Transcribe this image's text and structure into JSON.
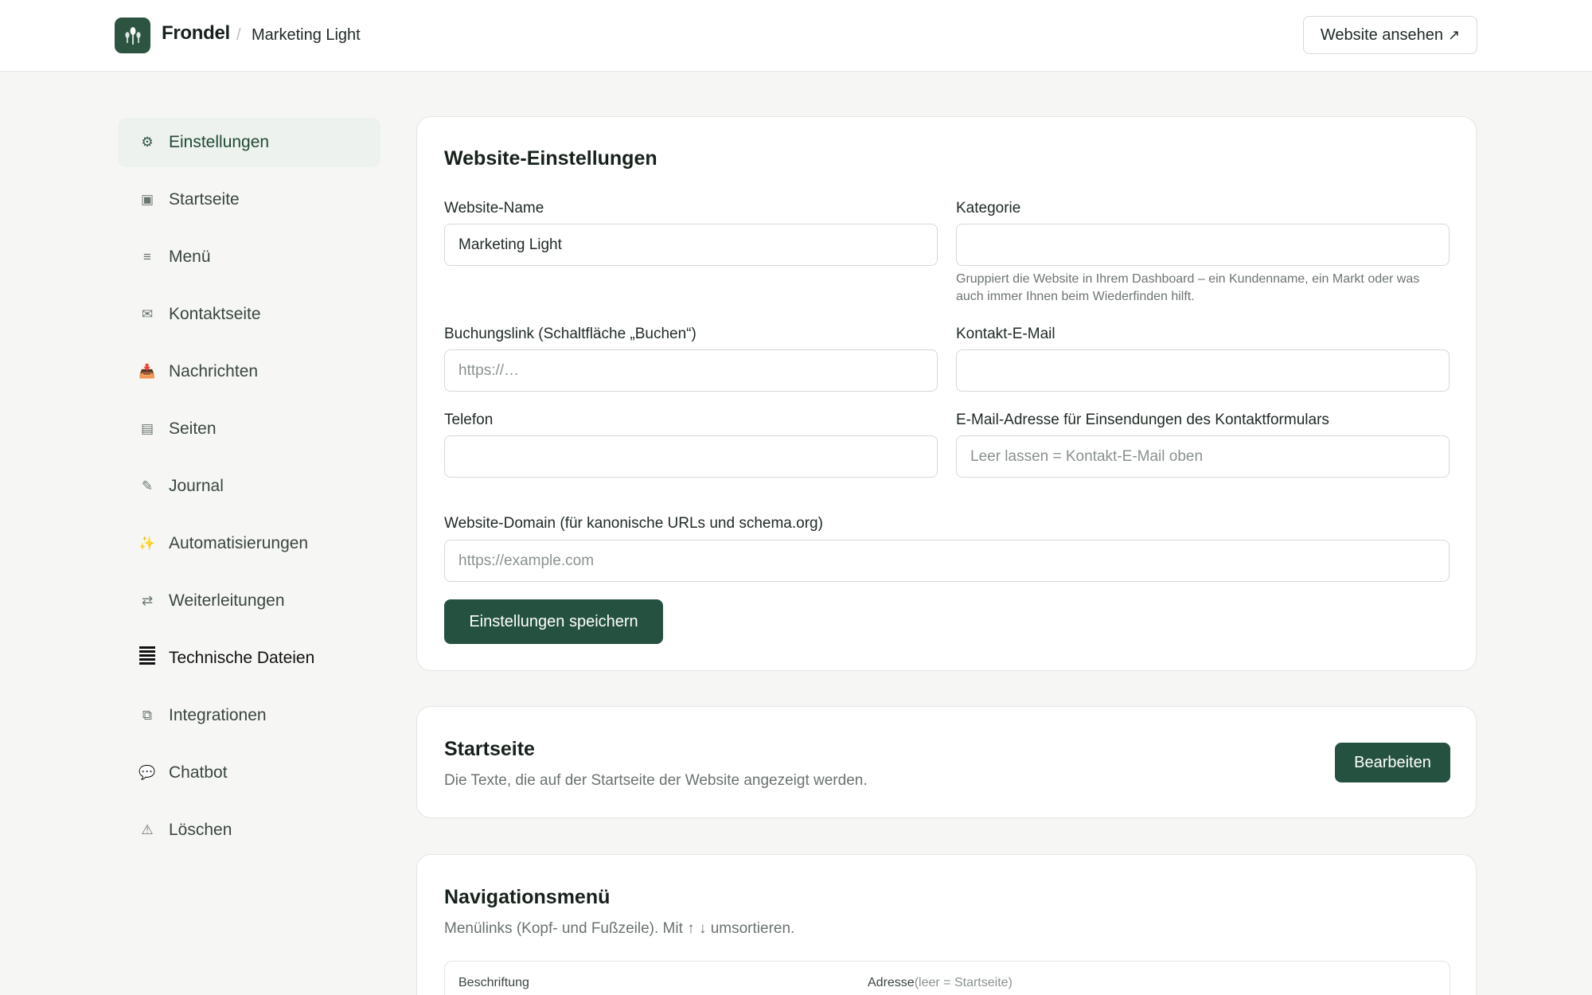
{
  "header": {
    "brand": "Frondel",
    "separator": "/",
    "site": "Marketing Light",
    "view_button": "Website ansehen",
    "view_button_arrow": "↗"
  },
  "sidebar": {
    "items": [
      {
        "label": "Einstellungen",
        "icon": "⚙",
        "icon_name": "gear-icon"
      },
      {
        "label": "Startseite",
        "icon": "▣",
        "icon_name": "home-square-icon"
      },
      {
        "label": "Menü",
        "icon": "≡",
        "icon_name": "menu-icon"
      },
      {
        "label": "Kontaktseite",
        "icon": "✉",
        "icon_name": "envelope-icon"
      },
      {
        "label": "Nachrichten",
        "icon": "📥",
        "icon_name": "inbox-icon"
      },
      {
        "label": "Seiten",
        "icon": "▤",
        "icon_name": "page-icon"
      },
      {
        "label": "Journal",
        "icon": "✎",
        "icon_name": "pencil-icon"
      },
      {
        "label": "Automatisierungen",
        "icon": "✨",
        "icon_name": "sparkles-icon"
      },
      {
        "label": "Weiterleitungen",
        "icon": "⇄",
        "icon_name": "redirect-arrows-icon"
      },
      {
        "label": "Technische Dateien",
        "icon": "𝄚",
        "icon_name": "file-lines-icon"
      },
      {
        "label": "Integrationen",
        "icon": "⧉",
        "icon_name": "integrations-icon"
      },
      {
        "label": "Chatbot",
        "icon": "💬",
        "icon_name": "chat-bubble-icon"
      },
      {
        "label": "Löschen",
        "icon": "⚠",
        "icon_name": "warning-icon"
      }
    ]
  },
  "settings": {
    "title": "Website-Einstellungen",
    "site_name_label": "Website-Name",
    "site_name_value": "Marketing Light",
    "category_label": "Kategorie",
    "category_value": "",
    "category_hint": "Gruppiert die Website in Ihrem Dashboard – ein Kundenname, ein Markt oder was auch immer Ihnen beim Wiederfinden hilft.",
    "booking_label": "Buchungslink (Schaltfläche „Buchen“)",
    "booking_placeholder": "https://…",
    "contact_email_label": "Kontakt-E-Mail",
    "contact_email_value": "",
    "phone_label": "Telefon",
    "phone_value": "",
    "form_email_label": "E-Mail-Adresse für Einsendungen des Kontaktformulars",
    "form_email_placeholder": "Leer lassen = Kontakt-E-Mail oben",
    "domain_label": "Website-Domain (für kanonische URLs und schema.org)",
    "domain_placeholder": "https://example.com",
    "save_button": "Einstellungen speichern"
  },
  "homepage": {
    "title": "Startseite",
    "description": "Die Texte, die auf der Startseite der Website angezeigt werden.",
    "edit_button": "Bearbeiten"
  },
  "navmenu": {
    "title": "Navigationsmenü",
    "description": "Menülinks (Kopf- und Fußzeile). Mit ↑ ↓ umsortieren.",
    "col_label": "Beschriftung",
    "col_address": "Adresse",
    "col_address_hint": "(leer = Startseite)"
  },
  "colors": {
    "accent": "#245140",
    "background": "#f6f7f5"
  }
}
